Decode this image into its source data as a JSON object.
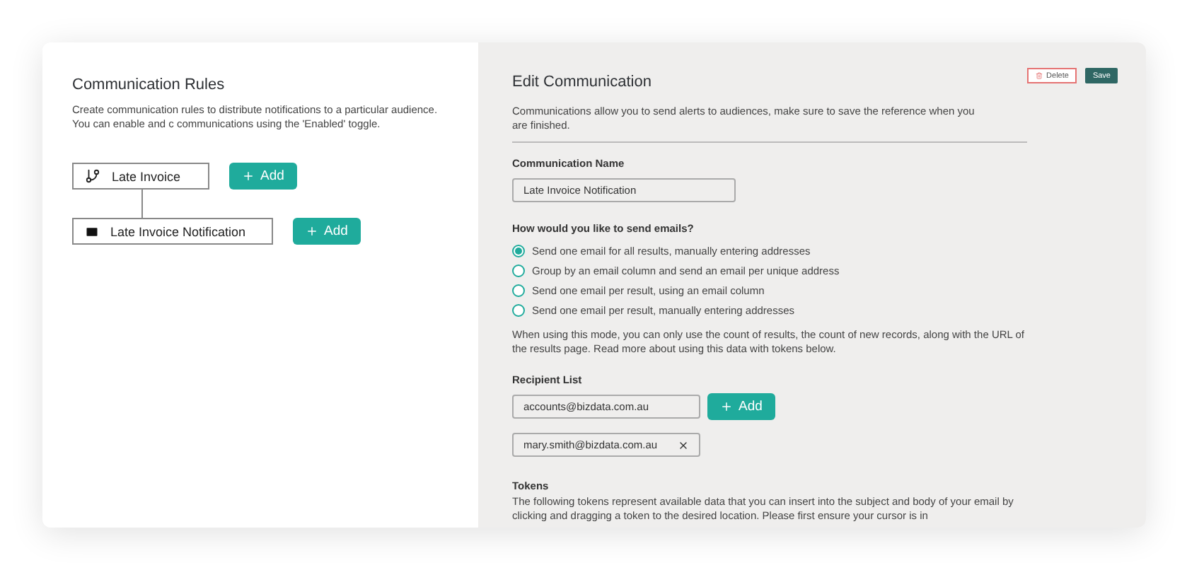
{
  "rules_panel": {
    "title": "Communication Rules",
    "description": "Create communication rules to distribute notifications to a particular audience. You can enable and c communications using the 'Enabled' toggle.",
    "nodes": [
      {
        "kind": "branch",
        "label": "Late Invoice",
        "button": "Add"
      },
      {
        "kind": "email",
        "label": "Late Invoice Notification",
        "button": "Add"
      }
    ]
  },
  "edit_panel": {
    "title": "Edit Communication",
    "delete_button": "Delete",
    "save_button": "Save",
    "intro": "Communications allow you to send alerts to audiences, make sure to save the reference when you are finished.",
    "name_label": "Communication Name",
    "name_value": "Late Invoice Notification",
    "send_question": "How would you like to send emails?",
    "send_options": [
      {
        "label": "Send one email for all results, manually entering addresses",
        "selected": true
      },
      {
        "label": "Group by an email column and send an email per unique address",
        "selected": false
      },
      {
        "label": "Send one email per result, using an email column",
        "selected": false
      },
      {
        "label": "Send one email per result, manually entering addresses",
        "selected": false
      }
    ],
    "mode_note": "When using this mode, you can only use the count of results, the count of new records, along with the URL of the results page. Read more about using this data with tokens below.",
    "recipient_label": "Recipient List",
    "recipient_input": "accounts@bizdata.com.au",
    "recipient_add": "Add",
    "recipients": [
      "mary.smith@bizdata.com.au"
    ],
    "tokens_label": "Tokens",
    "tokens_text": "The following tokens represent available data that you can insert into the subject and body of your email by clicking and dragging a token to the desired location. Please first ensure your cursor is in"
  }
}
